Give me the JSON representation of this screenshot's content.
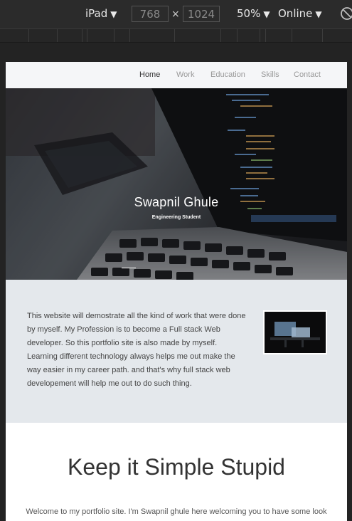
{
  "devtools": {
    "device": "iPad",
    "width": "768",
    "height": "1024",
    "times": "×",
    "zoom": "50%",
    "network": "Online",
    "caret": "▼"
  },
  "nav": {
    "items": [
      {
        "label": "Home",
        "active": true
      },
      {
        "label": "Work"
      },
      {
        "label": "Education"
      },
      {
        "label": "Skills"
      },
      {
        "label": "Contact"
      }
    ]
  },
  "hero": {
    "title": "Swapnil Ghule",
    "subtitle": "Engineering Student"
  },
  "about": {
    "text": "This website will demostrate all the kind of work that were done by myself. My Profession is to become a Full stack Web developer. So this portfolio site is also made by myself. Learning different technology always helps me out make the way easier in my career path. and that's why full stack web developement will help me out to do such thing."
  },
  "kiss": {
    "title": "Keep it Simple Stupid",
    "text": "Welcome to my portfolio site. I'm Swapnil ghule here welcoming you to have some look"
  }
}
